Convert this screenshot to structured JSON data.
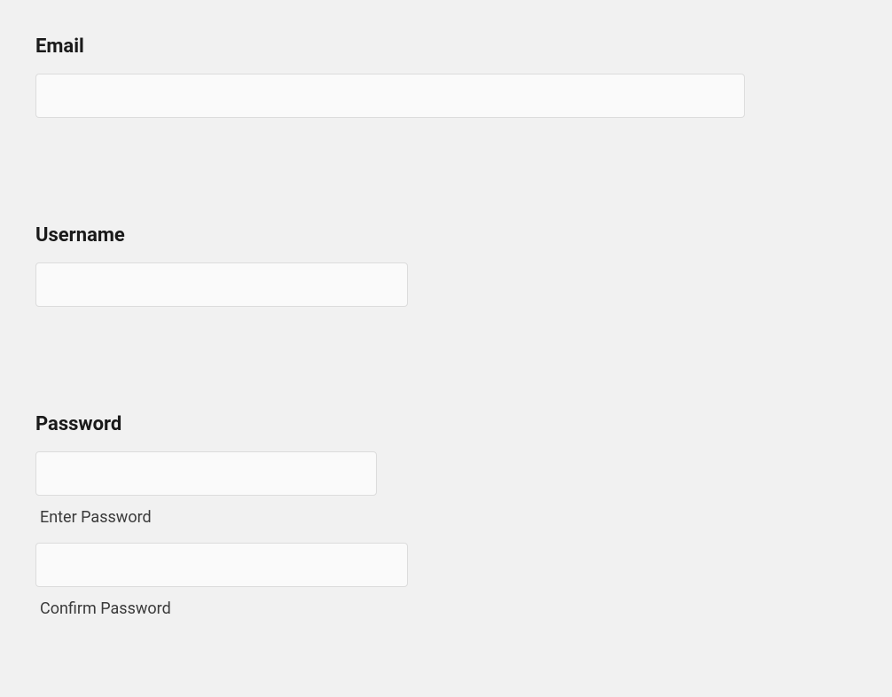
{
  "email": {
    "label": "Email",
    "value": ""
  },
  "username": {
    "label": "Username",
    "value": ""
  },
  "password": {
    "label": "Password",
    "enter_label": "Enter Password",
    "confirm_label": "Confirm Password",
    "value": "",
    "confirm_value": ""
  }
}
